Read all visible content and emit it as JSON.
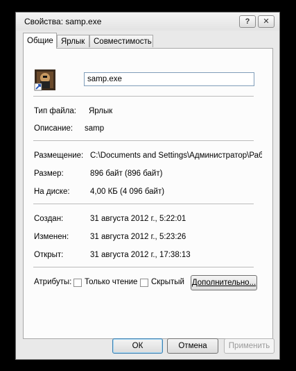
{
  "window": {
    "title": "Свойства: samp.exe",
    "help_label": "?",
    "close_label": "X"
  },
  "tabs": [
    {
      "label": "Общие"
    },
    {
      "label": "Ярлык"
    },
    {
      "label": "Совместимость"
    }
  ],
  "general": {
    "file_name": "samp.exe",
    "type_label": "Тип файла:",
    "type_value": "Ярлык",
    "description_label": "Описание:",
    "description_value": "samp",
    "location_label": "Размещение:",
    "location_value": "C:\\Documents and Settings\\Администратор\\Раб",
    "size_label": "Размер:",
    "size_value": "896 байт (896 байт)",
    "disk_label": "На диске:",
    "disk_value": "4,00 КБ (4 096 байт)",
    "created_label": "Создан:",
    "created_value": "31 августа 2012 г., 5:22:01",
    "modified_label": "Изменен:",
    "modified_value": "31 августа 2012 г., 5:23:26",
    "accessed_label": "Открыт:",
    "accessed_value": "31 августа 2012 г., 17:38:13",
    "attributes_label": "Атрибуты:",
    "readonly_label": "Только чтение",
    "readonly_checked": false,
    "hidden_label": "Скрытый",
    "hidden_checked": false,
    "advanced_label": "Дополнительно..."
  },
  "buttons": {
    "ok": "ОК",
    "cancel": "Отмена",
    "apply": "Применить"
  }
}
